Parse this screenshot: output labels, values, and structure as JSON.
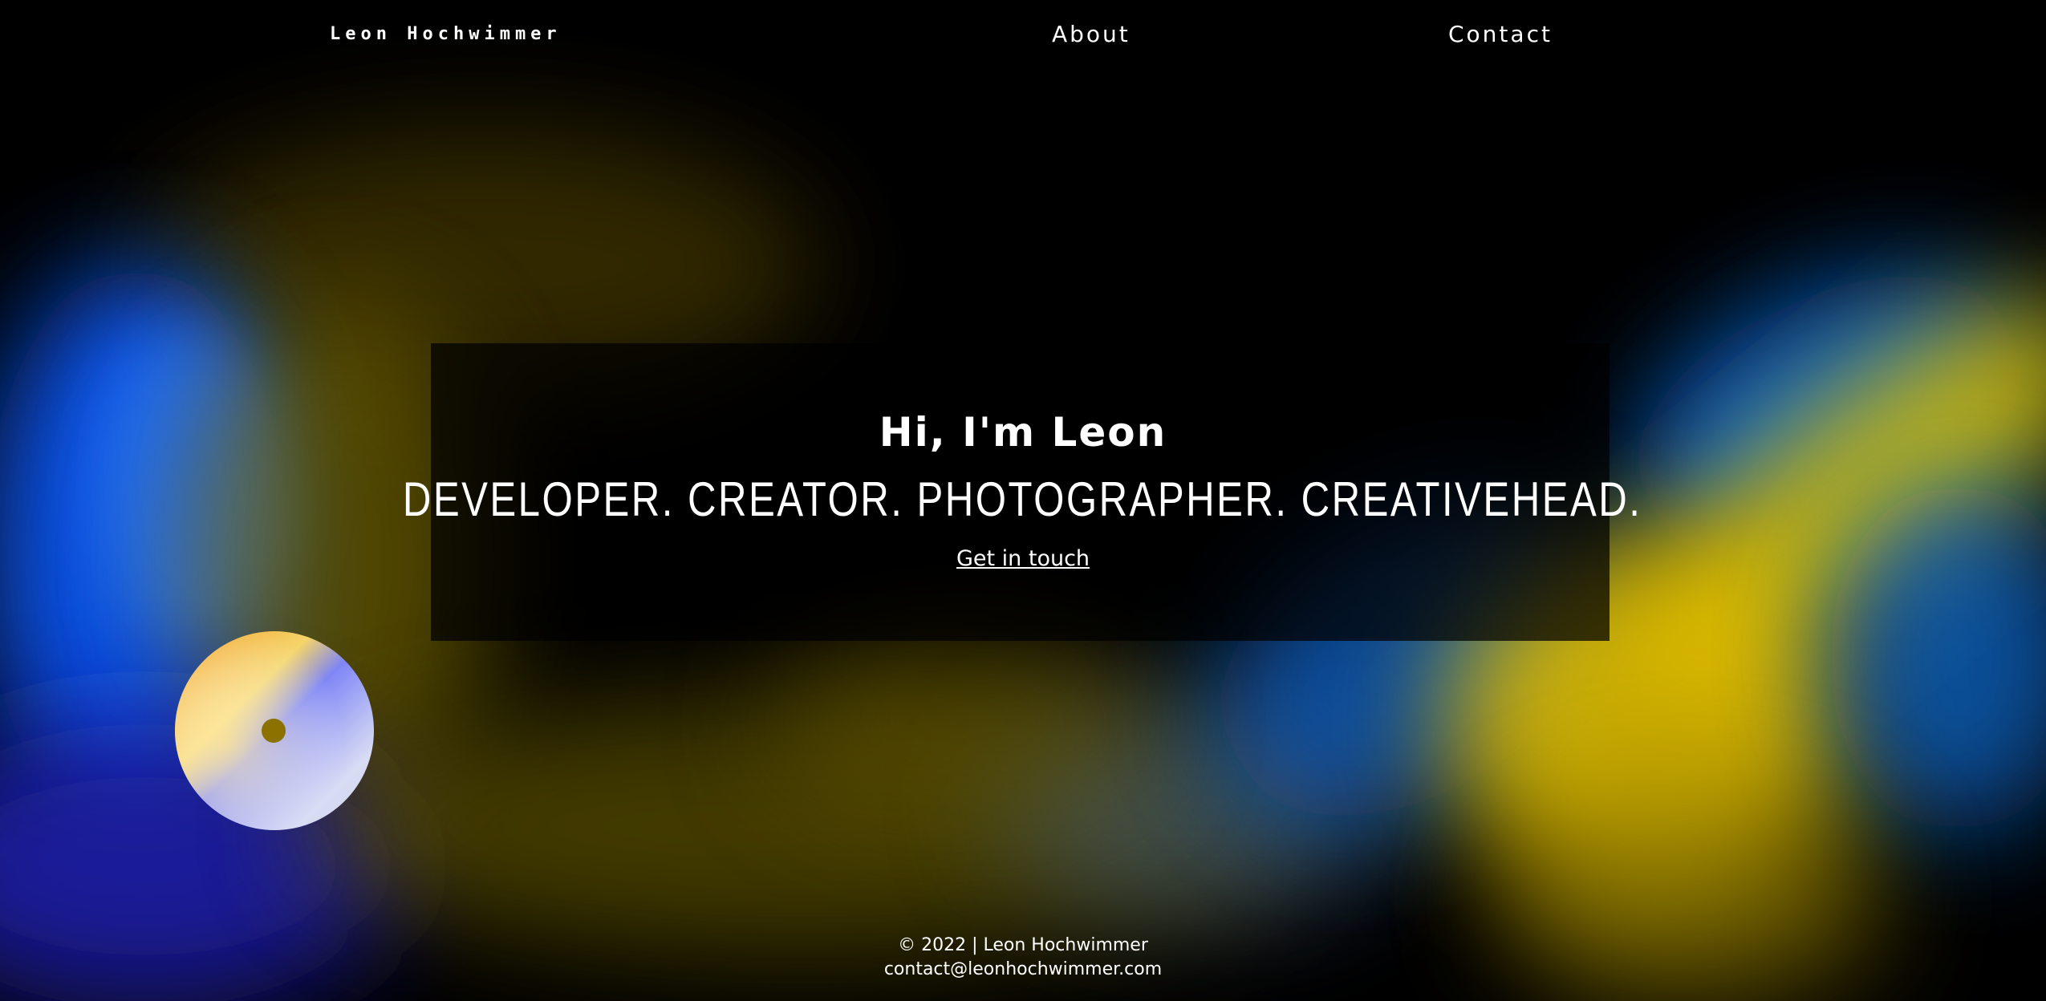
{
  "header": {
    "brand": "Leon Hochwimmer",
    "nav": [
      {
        "label": "About"
      },
      {
        "label": "Contact"
      }
    ]
  },
  "hero": {
    "greeting": "Hi, I'm Leon",
    "tagline": "DEVELOPER. CREATOR. PHOTOGRAPHER. CREATIVEHEAD.",
    "cta_label": "Get in touch"
  },
  "footer": {
    "copyright": "© 2022 | Leon Hochwimmer",
    "email": "contact@leonhochwimmer.com"
  },
  "colors": {
    "background": "#000000",
    "text": "#ffffff",
    "accent_yellow": "#e8c400",
    "accent_blue": "#0a5cff",
    "accent_navy": "#1a1a9e"
  }
}
